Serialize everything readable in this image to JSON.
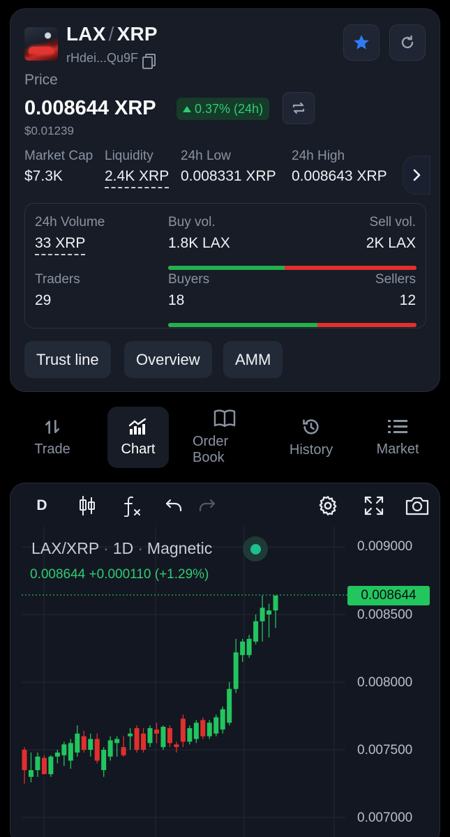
{
  "token": {
    "base": "LAX",
    "quote": "XRP",
    "address": "rHdei...Qu9F",
    "price_label": "Price",
    "price": "0.008644 XRP",
    "change": "0.37% (24h)",
    "usd_price": "$0.01239"
  },
  "stats": [
    {
      "label": "Market Cap",
      "value": "$7.3K"
    },
    {
      "label": "Liquidity",
      "value": "2.4K XRP"
    },
    {
      "label": "24h Low",
      "value": "0.008331 XRP"
    },
    {
      "label": "24h High",
      "value": "0.008643 XRP"
    }
  ],
  "volume": {
    "label": "24h Volume",
    "value": "33 XRP",
    "buy_label": "Buy vol.",
    "buy_value": "1.8K LAX",
    "sell_label": "Sell vol.",
    "sell_value": "2K LAX",
    "buy_fraction": 0.47
  },
  "traders": {
    "label": "Traders",
    "value": "29",
    "buyers_label": "Buyers",
    "buyers_value": "18",
    "sellers_label": "Sellers",
    "sellers_value": "12",
    "buyers_fraction": 0.6
  },
  "chips": [
    "Trust line",
    "Overview",
    "AMM"
  ],
  "tabs": [
    {
      "label": "Trade",
      "icon": "trade-arrows-icon"
    },
    {
      "label": "Chart",
      "icon": "bar-chart-icon",
      "active": true
    },
    {
      "label": "Order Book",
      "icon": "book-icon"
    },
    {
      "label": "History",
      "icon": "history-clock-icon"
    },
    {
      "label": "Market",
      "icon": "list-icon"
    }
  ],
  "chart_toolbar": {
    "interval": "D",
    "icons": [
      "candles-icon",
      "indicators-fx-icon",
      "undo-icon",
      "redo-icon",
      "settings-gear-icon",
      "fullscreen-icon",
      "camera-icon"
    ]
  },
  "chart_legend": {
    "symbol": "LAX/XRP",
    "interval": "1D",
    "mode": "Magnetic",
    "ohlc_text": "0.008644 +0.000110 (+1.29%)"
  },
  "colors": {
    "up": "#22c55e",
    "down": "#e0302d",
    "accent_blue": "#2f7bf5",
    "background": "#131722"
  },
  "chart_data": {
    "type": "candlestick",
    "symbol": "LAX/XRP",
    "interval": "1D",
    "y_ticks": [
      "0.009000",
      "0.008500",
      "0.008000",
      "0.007500",
      "0.007000"
    ],
    "ylim": [
      0.00695,
      0.00908
    ],
    "last_price": "0.008644",
    "candles": [
      {
        "o": 0.0075,
        "h": 0.00752,
        "l": 0.00725,
        "c": 0.00735
      },
      {
        "o": 0.0073,
        "h": 0.00748,
        "l": 0.00726,
        "c": 0.00735
      },
      {
        "o": 0.00735,
        "h": 0.00748,
        "l": 0.0073,
        "c": 0.00745
      },
      {
        "o": 0.00744,
        "h": 0.00746,
        "l": 0.00732,
        "c": 0.00732
      },
      {
        "o": 0.00732,
        "h": 0.00746,
        "l": 0.0073,
        "c": 0.00745
      },
      {
        "o": 0.00745,
        "h": 0.0075,
        "l": 0.0074,
        "c": 0.00748
      },
      {
        "o": 0.00746,
        "h": 0.00756,
        "l": 0.00738,
        "c": 0.00754
      },
      {
        "o": 0.00742,
        "h": 0.00758,
        "l": 0.00736,
        "c": 0.00755
      },
      {
        "o": 0.00748,
        "h": 0.00768,
        "l": 0.00745,
        "c": 0.00762
      },
      {
        "o": 0.0076,
        "h": 0.00764,
        "l": 0.00748,
        "c": 0.0075
      },
      {
        "o": 0.0075,
        "h": 0.00762,
        "l": 0.00745,
        "c": 0.00758
      },
      {
        "o": 0.00758,
        "h": 0.00762,
        "l": 0.0074,
        "c": 0.00742
      },
      {
        "o": 0.00735,
        "h": 0.00752,
        "l": 0.0073,
        "c": 0.0075
      },
      {
        "o": 0.00745,
        "h": 0.0076,
        "l": 0.00742,
        "c": 0.00757
      },
      {
        "o": 0.00755,
        "h": 0.0076,
        "l": 0.00745,
        "c": 0.00758
      },
      {
        "o": 0.00752,
        "h": 0.0076,
        "l": 0.00745,
        "c": 0.00746
      },
      {
        "o": 0.0076,
        "h": 0.00766,
        "l": 0.0075,
        "c": 0.00762
      },
      {
        "o": 0.00766,
        "h": 0.00768,
        "l": 0.00748,
        "c": 0.0075
      },
      {
        "o": 0.00762,
        "h": 0.00766,
        "l": 0.00748,
        "c": 0.0075
      },
      {
        "o": 0.00755,
        "h": 0.00768,
        "l": 0.00752,
        "c": 0.00766
      },
      {
        "o": 0.00765,
        "h": 0.0077,
        "l": 0.00755,
        "c": 0.00762
      },
      {
        "o": 0.00752,
        "h": 0.00768,
        "l": 0.0075,
        "c": 0.00767
      },
      {
        "o": 0.00766,
        "h": 0.00768,
        "l": 0.00752,
        "c": 0.00755
      },
      {
        "o": 0.00754,
        "h": 0.00756,
        "l": 0.00748,
        "c": 0.00752
      },
      {
        "o": 0.00773,
        "h": 0.00776,
        "l": 0.00752,
        "c": 0.00756
      },
      {
        "o": 0.00756,
        "h": 0.00768,
        "l": 0.00754,
        "c": 0.00766
      },
      {
        "o": 0.00758,
        "h": 0.00772,
        "l": 0.00755,
        "c": 0.0077
      },
      {
        "o": 0.00772,
        "h": 0.00774,
        "l": 0.00758,
        "c": 0.0076
      },
      {
        "o": 0.0076,
        "h": 0.00772,
        "l": 0.00758,
        "c": 0.0077
      },
      {
        "o": 0.00762,
        "h": 0.00776,
        "l": 0.0076,
        "c": 0.00774
      },
      {
        "o": 0.00765,
        "h": 0.00782,
        "l": 0.00762,
        "c": 0.0078
      },
      {
        "o": 0.0077,
        "h": 0.008,
        "l": 0.00768,
        "c": 0.00795
      },
      {
        "o": 0.00795,
        "h": 0.00832,
        "l": 0.00792,
        "c": 0.00822
      },
      {
        "o": 0.0082,
        "h": 0.00832,
        "l": 0.00815,
        "c": 0.0083
      },
      {
        "o": 0.0082,
        "h": 0.00835,
        "l": 0.00818,
        "c": 0.00832
      },
      {
        "o": 0.0083,
        "h": 0.0085,
        "l": 0.00828,
        "c": 0.00845
      },
      {
        "o": 0.00845,
        "h": 0.00864,
        "l": 0.0083,
        "c": 0.00855
      },
      {
        "o": 0.0085,
        "h": 0.00858,
        "l": 0.00833,
        "c": 0.00853
      },
      {
        "o": 0.00853,
        "h": 0.00864,
        "l": 0.0084,
        "c": 0.00864
      }
    ]
  }
}
